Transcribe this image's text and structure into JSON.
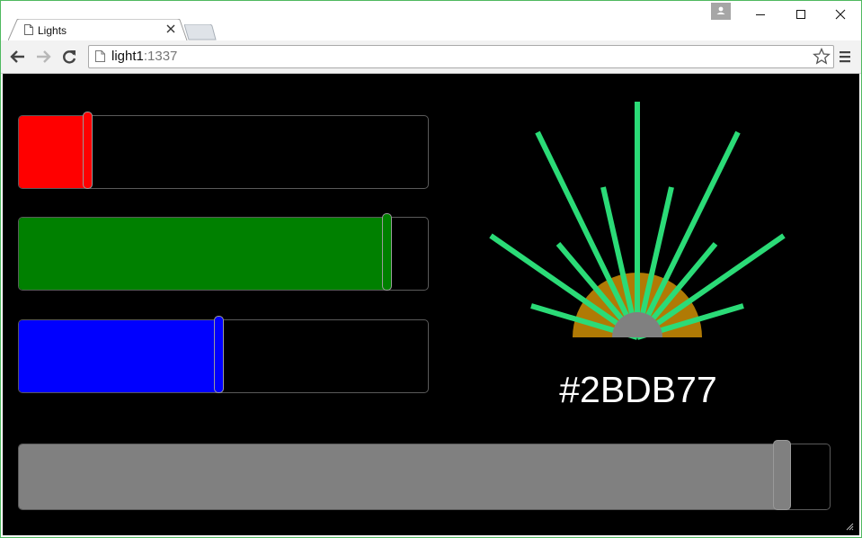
{
  "browser": {
    "tab": {
      "title": "Lights",
      "favicon": "page-icon",
      "close_icon": "close-icon"
    },
    "window_controls": [
      "minimize-icon",
      "maximize-icon",
      "close-icon"
    ],
    "address_bar": {
      "host": "light1",
      "port": ":1337"
    },
    "icons": {
      "back": "back-arrow-icon",
      "forward": "forward-arrow-icon",
      "reload": "reload-icon",
      "bookmark": "star-icon",
      "menu": "hamburger-menu-icon",
      "profile": "profile-icon"
    }
  },
  "sliders": [
    {
      "name": "red",
      "color": "#ff0000",
      "value_fraction": 0.17
    },
    {
      "name": "green",
      "color": "#008000",
      "value_fraction": 0.9
    },
    {
      "name": "blue",
      "color": "#0000ff",
      "value_fraction": 0.49
    }
  ],
  "brightness": {
    "color": "#808080",
    "value_fraction": 0.94
  },
  "preview": {
    "hex": "#2BDB77",
    "ray_color": "#2bdb77",
    "glow_color": "#b07a05",
    "bulb_color": "#808080",
    "ray_angles_deg": [
      -90,
      -64,
      -30,
      -17,
      0,
      17,
      30,
      64,
      90,
      -73,
      -45,
      45,
      73
    ]
  },
  "colors": {
    "background": "#000000",
    "window_border": "#4fb95f",
    "label": "#ffffff"
  }
}
